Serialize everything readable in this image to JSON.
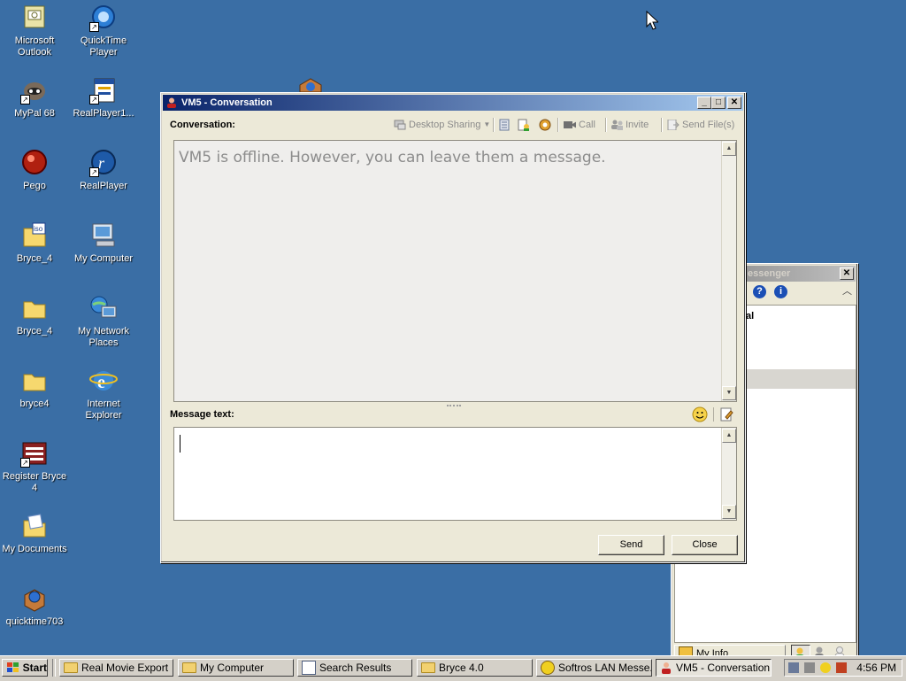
{
  "desktop": {
    "icons": [
      {
        "label": "Microsoft Outlook",
        "icon": "outlook-icon"
      },
      {
        "label": "QuickTime Player",
        "icon": "quicktime-icon"
      },
      {
        "label": "MyPal 68",
        "icon": "mypal-icon"
      },
      {
        "label": "RealPlayer1...",
        "icon": "realplayer-installer-icon"
      },
      {
        "label": "Pego",
        "icon": "pego-icon"
      },
      {
        "label": "RealPlayer",
        "icon": "realplayer-icon"
      },
      {
        "label": "Bryce_4",
        "icon": "iso-file-icon"
      },
      {
        "label": "My Computer",
        "icon": "my-computer-icon"
      },
      {
        "label": "Bryce_4",
        "icon": "folder-icon"
      },
      {
        "label": "My Network Places",
        "icon": "network-places-icon"
      },
      {
        "label": "bryce4",
        "icon": "folder-icon"
      },
      {
        "label": "Internet Explorer",
        "icon": "internet-explorer-icon"
      },
      {
        "label": "Register Bryce 4",
        "icon": "register-icon"
      },
      {
        "label": "My Documents",
        "icon": "my-documents-icon"
      },
      {
        "label": "quicktime703",
        "icon": "installer-icon"
      }
    ]
  },
  "conversation_window": {
    "title": "VM5 - Conversation",
    "conversation_label": "Conversation:",
    "toolbar": {
      "desktop_sharing": "Desktop Sharing",
      "call": "Call",
      "invite": "Invite",
      "send_files": "Send File(s)"
    },
    "offline_message": "VM5 is offline. However, you can leave them a message.",
    "message_label": "Message text:",
    "message_value": "",
    "send_label": "Send",
    "close_label": "Close"
  },
  "messenger_window": {
    "title_fragment": "essenger",
    "contact_fragment": "al",
    "my_info_label": "My Info"
  },
  "taskbar": {
    "start_label": "Start",
    "items": [
      {
        "label": "Real Movie Export"
      },
      {
        "label": "My Computer"
      },
      {
        "label": "Search Results"
      },
      {
        "label": "Bryce 4.0"
      },
      {
        "label": "Softros LAN Messe..."
      },
      {
        "label": "VM5 - Conversation"
      }
    ],
    "clock": "4:56 PM"
  },
  "colors": {
    "desktop": "#3a6ea5",
    "title_active": "#0a246a",
    "conversation_bg": "#efeeec"
  }
}
